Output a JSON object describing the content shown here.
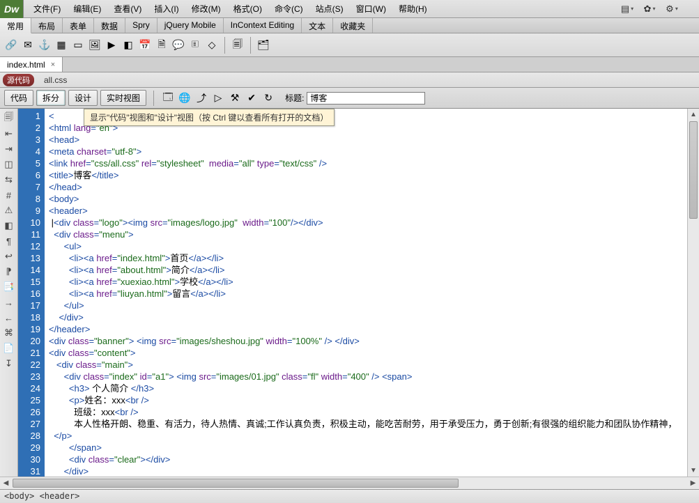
{
  "logo": "Dw",
  "menus": [
    "文件(F)",
    "编辑(E)",
    "查看(V)",
    "插入(I)",
    "修改(M)",
    "格式(O)",
    "命令(C)",
    "站点(S)",
    "窗口(W)",
    "帮助(H)"
  ],
  "tabs": [
    "常用",
    "布局",
    "表单",
    "数据",
    "Spry",
    "jQuery Mobile",
    "InContext Editing",
    "文本",
    "收藏夹"
  ],
  "active_tab": "常用",
  "doc_tab": {
    "name": "index.html",
    "close": "×"
  },
  "source_pill": "源代码",
  "css_link": "all.css",
  "view_buttons": {
    "code": "代码",
    "split": "拆分",
    "design": "设计",
    "live": "实时视图"
  },
  "title_label": "标题:",
  "title_value": "博客",
  "tooltip": "显示\"代码\"视图和\"设计\"视图（按 Ctrl 键以查看所有打开的文档）",
  "status_path": "<body> <header>",
  "code_lines": [
    [
      [
        "punct",
        "<"
      ]
    ],
    [
      [
        "punct",
        "<"
      ],
      [
        "tagname",
        "html "
      ],
      [
        "attr",
        "lang"
      ],
      [
        "punct",
        "="
      ],
      [
        "val",
        "\"en\""
      ],
      [
        "punct",
        ">"
      ]
    ],
    [
      [
        "punct",
        "<"
      ],
      [
        "tagname",
        "head"
      ],
      [
        "punct",
        ">"
      ]
    ],
    [
      [
        "punct",
        "<"
      ],
      [
        "tagname",
        "meta "
      ],
      [
        "attr",
        "charset"
      ],
      [
        "punct",
        "="
      ],
      [
        "val",
        "\"utf-8\""
      ],
      [
        "punct",
        ">"
      ]
    ],
    [
      [
        "punct",
        "<"
      ],
      [
        "tagname",
        "link "
      ],
      [
        "attr",
        "href"
      ],
      [
        "punct",
        "="
      ],
      [
        "val",
        "\"css/all.css\""
      ],
      [
        "txt",
        " "
      ],
      [
        "attr",
        "rel"
      ],
      [
        "punct",
        "="
      ],
      [
        "val",
        "\"stylesheet\""
      ],
      [
        "txt",
        "  "
      ],
      [
        "attr",
        "media"
      ],
      [
        "punct",
        "="
      ],
      [
        "val",
        "\"all\""
      ],
      [
        "txt",
        " "
      ],
      [
        "attr",
        "type"
      ],
      [
        "punct",
        "="
      ],
      [
        "val",
        "\"text/css\""
      ],
      [
        "txt",
        " "
      ],
      [
        "punct",
        "/>"
      ]
    ],
    [
      [
        "punct",
        "<"
      ],
      [
        "tagname",
        "title"
      ],
      [
        "punct",
        ">"
      ],
      [
        "txt",
        "博客"
      ],
      [
        "punct",
        "</"
      ],
      [
        "tagname",
        "title"
      ],
      [
        "punct",
        ">"
      ]
    ],
    [
      [
        "punct",
        "</"
      ],
      [
        "tagname",
        "head"
      ],
      [
        "punct",
        ">"
      ]
    ],
    [
      [
        "punct",
        "<"
      ],
      [
        "tagname",
        "body"
      ],
      [
        "punct",
        ">"
      ]
    ],
    [
      [
        "punct",
        "<"
      ],
      [
        "tagname",
        "header"
      ],
      [
        "punct",
        ">"
      ]
    ],
    [
      [
        "txt",
        " |"
      ],
      [
        "punct",
        "<"
      ],
      [
        "tagname",
        "div "
      ],
      [
        "attr",
        "class"
      ],
      [
        "punct",
        "="
      ],
      [
        "val",
        "\"logo\""
      ],
      [
        "punct",
        "><"
      ],
      [
        "tagname",
        "img "
      ],
      [
        "attr",
        "src"
      ],
      [
        "punct",
        "="
      ],
      [
        "val",
        "\"images/logo.jpg\""
      ],
      [
        "txt",
        "  "
      ],
      [
        "attr",
        "width"
      ],
      [
        "punct",
        "="
      ],
      [
        "val",
        "\"100\""
      ],
      [
        "punct",
        "/></"
      ],
      [
        "tagname",
        "div"
      ],
      [
        "punct",
        ">"
      ]
    ],
    [
      [
        "txt",
        "  "
      ],
      [
        "punct",
        "<"
      ],
      [
        "tagname",
        "div "
      ],
      [
        "attr",
        "class"
      ],
      [
        "punct",
        "="
      ],
      [
        "val",
        "\"menu\""
      ],
      [
        "punct",
        ">"
      ]
    ],
    [
      [
        "txt",
        "      "
      ],
      [
        "punct",
        "<"
      ],
      [
        "tagname",
        "ul"
      ],
      [
        "punct",
        ">"
      ]
    ],
    [
      [
        "txt",
        "        "
      ],
      [
        "punct",
        "<"
      ],
      [
        "tagname",
        "li"
      ],
      [
        "punct",
        "><"
      ],
      [
        "tagname",
        "a "
      ],
      [
        "attr",
        "href"
      ],
      [
        "punct",
        "="
      ],
      [
        "val",
        "\"index.html\""
      ],
      [
        "punct",
        ">"
      ],
      [
        "txt",
        "首页"
      ],
      [
        "punct",
        "</"
      ],
      [
        "tagname",
        "a"
      ],
      [
        "punct",
        "></"
      ],
      [
        "tagname",
        "li"
      ],
      [
        "punct",
        ">"
      ]
    ],
    [
      [
        "txt",
        "        "
      ],
      [
        "punct",
        "<"
      ],
      [
        "tagname",
        "li"
      ],
      [
        "punct",
        "><"
      ],
      [
        "tagname",
        "a "
      ],
      [
        "attr",
        "href"
      ],
      [
        "punct",
        "="
      ],
      [
        "val",
        "\"about.html\""
      ],
      [
        "punct",
        ">"
      ],
      [
        "txt",
        "简介"
      ],
      [
        "punct",
        "</"
      ],
      [
        "tagname",
        "a"
      ],
      [
        "punct",
        "></"
      ],
      [
        "tagname",
        "li"
      ],
      [
        "punct",
        ">"
      ]
    ],
    [
      [
        "txt",
        "        "
      ],
      [
        "punct",
        "<"
      ],
      [
        "tagname",
        "li"
      ],
      [
        "punct",
        "><"
      ],
      [
        "tagname",
        "a "
      ],
      [
        "attr",
        "href"
      ],
      [
        "punct",
        "="
      ],
      [
        "val",
        "\"xuexiao.html\""
      ],
      [
        "punct",
        ">"
      ],
      [
        "txt",
        "学校"
      ],
      [
        "punct",
        "</"
      ],
      [
        "tagname",
        "a"
      ],
      [
        "punct",
        "></"
      ],
      [
        "tagname",
        "li"
      ],
      [
        "punct",
        ">"
      ]
    ],
    [
      [
        "txt",
        "        "
      ],
      [
        "punct",
        "<"
      ],
      [
        "tagname",
        "li"
      ],
      [
        "punct",
        "><"
      ],
      [
        "tagname",
        "a "
      ],
      [
        "attr",
        "href"
      ],
      [
        "punct",
        "="
      ],
      [
        "val",
        "\"liuyan.html\""
      ],
      [
        "punct",
        ">"
      ],
      [
        "txt",
        "留言"
      ],
      [
        "punct",
        "</"
      ],
      [
        "tagname",
        "a"
      ],
      [
        "punct",
        "></"
      ],
      [
        "tagname",
        "li"
      ],
      [
        "punct",
        ">"
      ]
    ],
    [
      [
        "txt",
        "      "
      ],
      [
        "punct",
        "</"
      ],
      [
        "tagname",
        "ul"
      ],
      [
        "punct",
        ">"
      ]
    ],
    [
      [
        "txt",
        "    "
      ],
      [
        "punct",
        "</"
      ],
      [
        "tagname",
        "div"
      ],
      [
        "punct",
        ">"
      ]
    ],
    [
      [
        "punct",
        "</"
      ],
      [
        "tagname",
        "header"
      ],
      [
        "punct",
        ">"
      ]
    ],
    [
      [
        "punct",
        "<"
      ],
      [
        "tagname",
        "div "
      ],
      [
        "attr",
        "class"
      ],
      [
        "punct",
        "="
      ],
      [
        "val",
        "\"banner\""
      ],
      [
        "punct",
        "> <"
      ],
      [
        "tagname",
        "img "
      ],
      [
        "attr",
        "src"
      ],
      [
        "punct",
        "="
      ],
      [
        "val",
        "\"images/sheshou.jpg\""
      ],
      [
        "txt",
        " "
      ],
      [
        "attr",
        "width"
      ],
      [
        "punct",
        "="
      ],
      [
        "val",
        "\"100%\""
      ],
      [
        "txt",
        " "
      ],
      [
        "punct",
        "/> </"
      ],
      [
        "tagname",
        "div"
      ],
      [
        "punct",
        ">"
      ]
    ],
    [
      [
        "punct",
        "<"
      ],
      [
        "tagname",
        "div "
      ],
      [
        "attr",
        "class"
      ],
      [
        "punct",
        "="
      ],
      [
        "val",
        "\"content\""
      ],
      [
        "punct",
        ">"
      ]
    ],
    [
      [
        "txt",
        "   "
      ],
      [
        "punct",
        "<"
      ],
      [
        "tagname",
        "div "
      ],
      [
        "attr",
        "class"
      ],
      [
        "punct",
        "="
      ],
      [
        "val",
        "\"main\""
      ],
      [
        "punct",
        ">"
      ]
    ],
    [
      [
        "txt",
        "      "
      ],
      [
        "punct",
        "<"
      ],
      [
        "tagname",
        "div "
      ],
      [
        "attr",
        "class"
      ],
      [
        "punct",
        "="
      ],
      [
        "val",
        "\"index\""
      ],
      [
        "txt",
        " "
      ],
      [
        "attr",
        "id"
      ],
      [
        "punct",
        "="
      ],
      [
        "val",
        "\"a1\""
      ],
      [
        "punct",
        "> <"
      ],
      [
        "tagname",
        "img "
      ],
      [
        "attr",
        "src"
      ],
      [
        "punct",
        "="
      ],
      [
        "val",
        "\"images/01.jpg\""
      ],
      [
        "txt",
        " "
      ],
      [
        "attr",
        "class"
      ],
      [
        "punct",
        "="
      ],
      [
        "val",
        "\"fl\""
      ],
      [
        "txt",
        " "
      ],
      [
        "attr",
        "width"
      ],
      [
        "punct",
        "="
      ],
      [
        "val",
        "\"400\""
      ],
      [
        "txt",
        " "
      ],
      [
        "punct",
        "/> <"
      ],
      [
        "tagname",
        "span"
      ],
      [
        "punct",
        ">"
      ]
    ],
    [
      [
        "txt",
        "        "
      ],
      [
        "punct",
        "<"
      ],
      [
        "tagname",
        "h3"
      ],
      [
        "punct",
        ">"
      ],
      [
        "txt",
        " 个人简介 "
      ],
      [
        "punct",
        "</"
      ],
      [
        "tagname",
        "h3"
      ],
      [
        "punct",
        ">"
      ]
    ],
    [
      [
        "txt",
        "        "
      ],
      [
        "punct",
        "<"
      ],
      [
        "tagname",
        "p"
      ],
      [
        "punct",
        ">"
      ],
      [
        "txt",
        "姓名：xxx"
      ],
      [
        "punct",
        "<"
      ],
      [
        "tagname",
        "br "
      ],
      [
        "punct",
        "/>"
      ]
    ],
    [
      [
        "txt",
        "          班级：xxx"
      ],
      [
        "punct",
        "<"
      ],
      [
        "tagname",
        "br "
      ],
      [
        "punct",
        "/>"
      ]
    ],
    [
      [
        "txt",
        "          本人性格开朗、稳重、有活力，待人热情、真诚;工作认真负责，积极主动，能吃苦耐劳，用于承受压力，勇于创新;有很强的组织能力和团队协作精神，"
      ]
    ],
    [
      [
        "txt",
        "  "
      ],
      [
        "punct",
        "</"
      ],
      [
        "tagname",
        "p"
      ],
      [
        "punct",
        ">"
      ]
    ],
    [
      [
        "txt",
        "        "
      ],
      [
        "punct",
        "</"
      ],
      [
        "tagname",
        "span"
      ],
      [
        "punct",
        ">"
      ]
    ],
    [
      [
        "txt",
        "        "
      ],
      [
        "punct",
        "<"
      ],
      [
        "tagname",
        "div "
      ],
      [
        "attr",
        "class"
      ],
      [
        "punct",
        "="
      ],
      [
        "val",
        "\"clear\""
      ],
      [
        "punct",
        "></"
      ],
      [
        "tagname",
        "div"
      ],
      [
        "punct",
        ">"
      ]
    ],
    [
      [
        "txt",
        "      "
      ],
      [
        "punct",
        "</"
      ],
      [
        "tagname",
        "div"
      ],
      [
        "punct",
        ">"
      ]
    ]
  ]
}
